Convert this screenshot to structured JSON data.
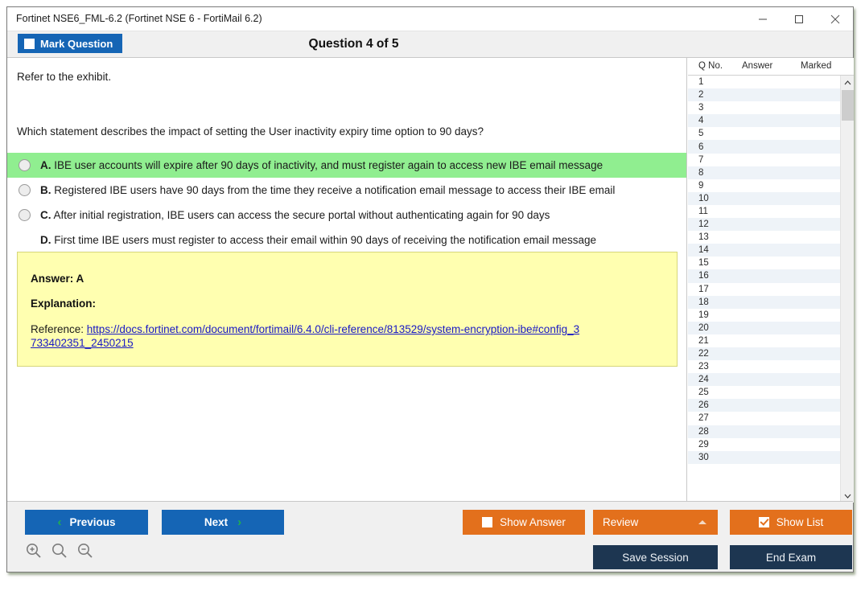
{
  "window": {
    "title": "Fortinet NSE6_FML-6.2 (Fortinet NSE 6 - FortiMail 6.2)",
    "minimize_label": "minimize",
    "maximize_label": "maximize",
    "close_label": "close"
  },
  "header": {
    "mark_question_label": "Mark Question",
    "mark_question_checked": false,
    "question_title": "Question 4 of 5"
  },
  "content": {
    "exhibit_line": "Refer to the exhibit.",
    "question_text": "Which statement describes the impact of setting the User inactivity expiry time option to 90 days?",
    "options": [
      {
        "letter": "A.",
        "text": "IBE user accounts will expire after 90 days of inactivity, and must register again to access new IBE email message",
        "selected": true,
        "has_radio": true
      },
      {
        "letter": "B.",
        "text": "Registered IBE users have 90 days from the time they receive a notification email message to access their IBE email",
        "selected": false,
        "has_radio": true
      },
      {
        "letter": "C.",
        "text": "After initial registration, IBE users can access the secure portal without authenticating again for 90 days",
        "selected": false,
        "has_radio": true
      },
      {
        "letter": "D.",
        "text": "First time IBE users must register to access their email within 90 days of receiving the notification email message",
        "selected": false,
        "has_radio": false
      }
    ]
  },
  "answer_panel": {
    "answer_label": "Answer: A",
    "explanation_label": "Explanation:",
    "reference_prefix": "Reference: ",
    "reference_url": "https://docs.fortinet.com/document/fortimail/6.4.0/cli-reference/813529/system-encryption-ibe#config_3733402351_2450215"
  },
  "question_list": {
    "columns": [
      "Q No.",
      "Answer",
      "Marked"
    ],
    "rows": [
      {
        "no": "1",
        "answer": "",
        "marked": ""
      },
      {
        "no": "2",
        "answer": "",
        "marked": ""
      },
      {
        "no": "3",
        "answer": "",
        "marked": ""
      },
      {
        "no": "4",
        "answer": "",
        "marked": ""
      },
      {
        "no": "5",
        "answer": "",
        "marked": ""
      },
      {
        "no": "6",
        "answer": "",
        "marked": ""
      },
      {
        "no": "7",
        "answer": "",
        "marked": ""
      },
      {
        "no": "8",
        "answer": "",
        "marked": ""
      },
      {
        "no": "9",
        "answer": "",
        "marked": ""
      },
      {
        "no": "10",
        "answer": "",
        "marked": ""
      },
      {
        "no": "11",
        "answer": "",
        "marked": ""
      },
      {
        "no": "12",
        "answer": "",
        "marked": ""
      },
      {
        "no": "13",
        "answer": "",
        "marked": ""
      },
      {
        "no": "14",
        "answer": "",
        "marked": ""
      },
      {
        "no": "15",
        "answer": "",
        "marked": ""
      },
      {
        "no": "16",
        "answer": "",
        "marked": ""
      },
      {
        "no": "17",
        "answer": "",
        "marked": ""
      },
      {
        "no": "18",
        "answer": "",
        "marked": ""
      },
      {
        "no": "19",
        "answer": "",
        "marked": ""
      },
      {
        "no": "20",
        "answer": "",
        "marked": ""
      },
      {
        "no": "21",
        "answer": "",
        "marked": ""
      },
      {
        "no": "22",
        "answer": "",
        "marked": ""
      },
      {
        "no": "23",
        "answer": "",
        "marked": ""
      },
      {
        "no": "24",
        "answer": "",
        "marked": ""
      },
      {
        "no": "25",
        "answer": "",
        "marked": ""
      },
      {
        "no": "26",
        "answer": "",
        "marked": ""
      },
      {
        "no": "27",
        "answer": "",
        "marked": ""
      },
      {
        "no": "28",
        "answer": "",
        "marked": ""
      },
      {
        "no": "29",
        "answer": "",
        "marked": ""
      },
      {
        "no": "30",
        "answer": "",
        "marked": ""
      }
    ]
  },
  "toolbar": {
    "previous_label": "Previous",
    "next_label": "Next",
    "prev_chevron": "‹",
    "next_chevron": "›",
    "show_answer_label": "Show Answer",
    "show_answer_checked": false,
    "review_label": "Review",
    "show_list_label": "Show List",
    "show_list_checked": true,
    "save_session_label": "Save Session",
    "end_exam_label": "End Exam",
    "zoom_in_label": "zoom-in",
    "zoom_reset_label": "zoom-reset",
    "zoom_out_label": "zoom-out"
  },
  "colors": {
    "primary_blue": "#1565b5",
    "orange": "#e3701c",
    "dark_navy": "#1d3651",
    "selected_green": "#90ee90",
    "answer_yellow": "#ffffb0",
    "link_blue": "#1919c4",
    "chevron_green": "#22b14c"
  }
}
